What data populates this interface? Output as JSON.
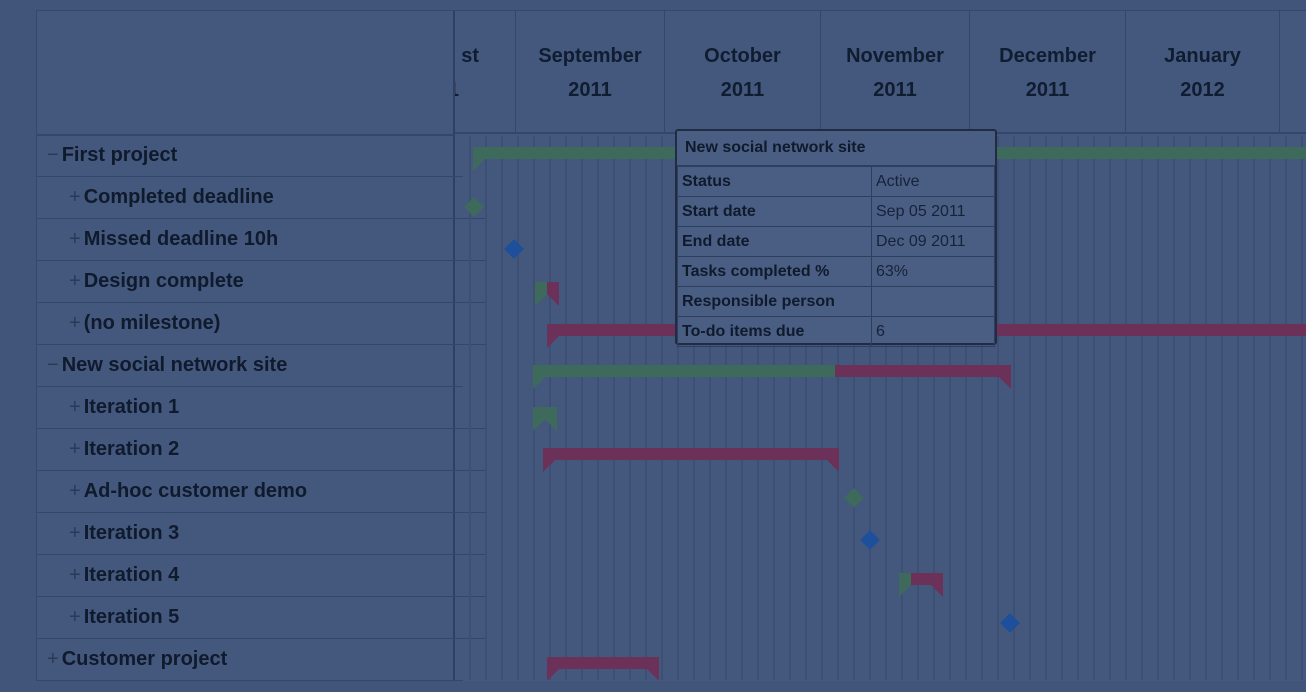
{
  "timeline": {
    "months": [
      {
        "month": "st",
        "year": "1"
      },
      {
        "month": "September",
        "year": "2011"
      },
      {
        "month": "October",
        "year": "2011"
      },
      {
        "month": "November",
        "year": "2011"
      },
      {
        "month": "December",
        "year": "2011"
      },
      {
        "month": "January",
        "year": "2012"
      }
    ]
  },
  "tasks": [
    {
      "sign": "−",
      "label": "First project"
    },
    {
      "sign": "+",
      "label": "Completed deadline"
    },
    {
      "sign": "+",
      "label": "Missed deadline 10h"
    },
    {
      "sign": "+",
      "label": "Design complete"
    },
    {
      "sign": "+",
      "label": "(no milestone)"
    },
    {
      "sign": "−",
      "label": "New social network site"
    },
    {
      "sign": "+",
      "label": "Iteration 1"
    },
    {
      "sign": "+",
      "label": "Iteration 2"
    },
    {
      "sign": "+",
      "label": "Ad-hoc customer demo"
    },
    {
      "sign": "+",
      "label": "Iteration 3"
    },
    {
      "sign": "+",
      "label": "Iteration 4"
    },
    {
      "sign": "+",
      "label": "Iteration 5"
    },
    {
      "sign": "+",
      "label": "Customer project"
    }
  ],
  "tooltip": {
    "title": "New social network site",
    "rows": [
      {
        "key": "Status",
        "value": "Active"
      },
      {
        "key": "Start date",
        "value": "Sep 05 2011"
      },
      {
        "key": "End date",
        "value": "Dec 09 2011"
      },
      {
        "key": "Tasks completed %",
        "value": "63%"
      },
      {
        "key": "Responsible person",
        "value": ""
      },
      {
        "key": "To-do items due",
        "value": "6"
      }
    ]
  },
  "colors": {
    "overlay_bg": "#41557a",
    "bar_green": "#3e6a5b",
    "bar_red": "#6b3158",
    "milestone_blue": "#1d4f9a"
  }
}
